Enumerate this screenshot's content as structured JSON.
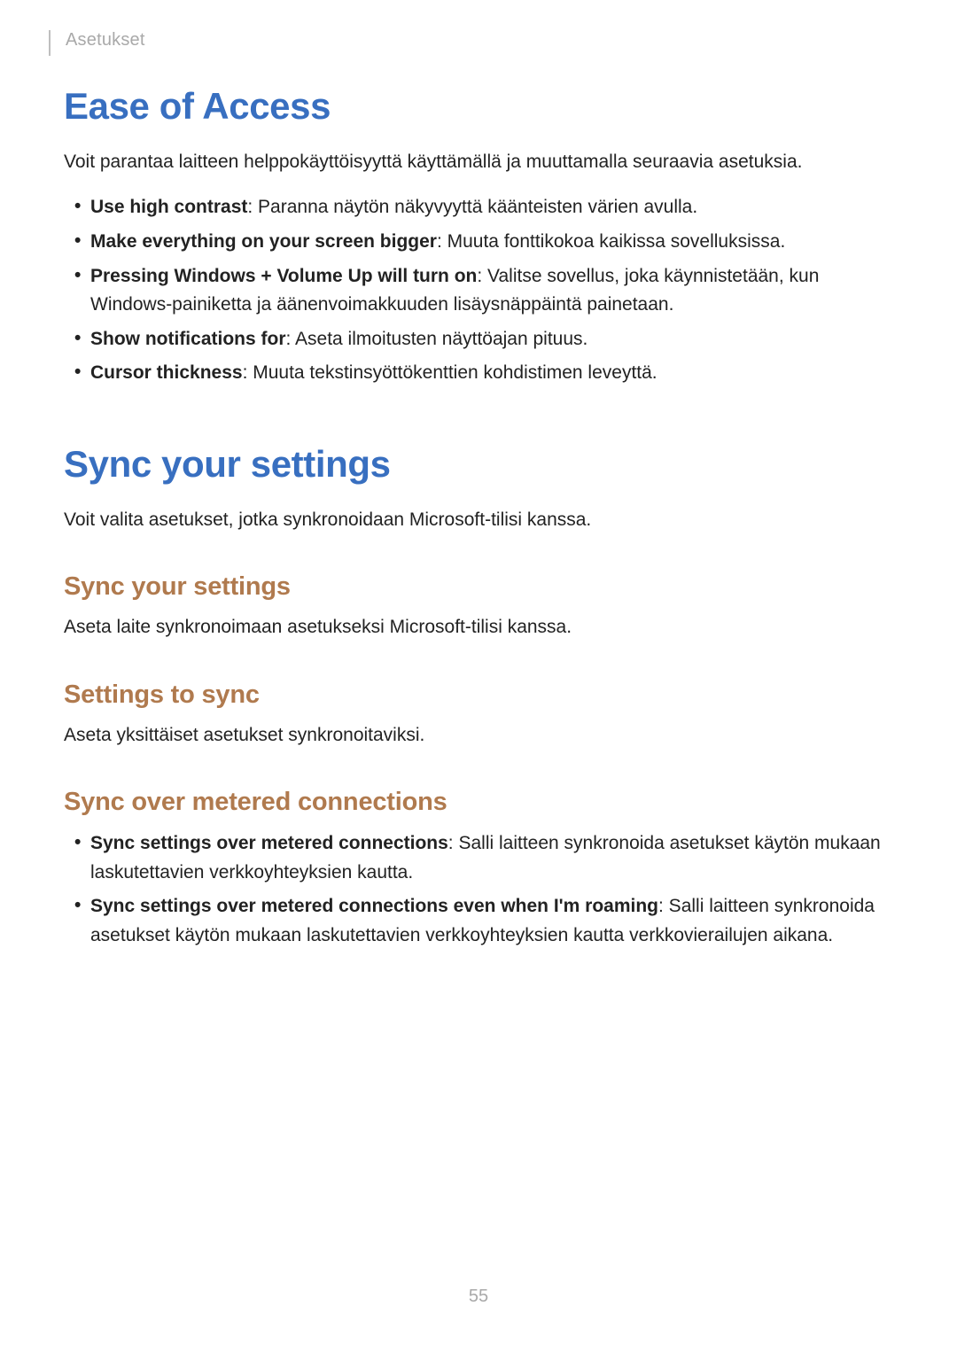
{
  "header": {
    "section": "Asetukset"
  },
  "ease": {
    "title": "Ease of Access",
    "intro": "Voit parantaa laitteen helppokäyttöisyyttä käyttämällä ja muuttamalla seuraavia asetuksia.",
    "items": [
      {
        "bold": "Use high contrast",
        "rest": ": Paranna näytön näkyvyyttä käänteisten värien avulla."
      },
      {
        "bold": "Make everything on your screen bigger",
        "rest": ": Muuta fonttikokoa kaikissa sovelluksissa."
      },
      {
        "bold": "Pressing Windows + Volume Up will turn on",
        "rest": ": Valitse sovellus, joka käynnistetään, kun Windows-painiketta ja äänenvoimakkuuden lisäysnäppäintä painetaan."
      },
      {
        "bold": "Show notifications for",
        "rest": ": Aseta ilmoitusten näyttöajan pituus."
      },
      {
        "bold": "Cursor thickness",
        "rest": ": Muuta tekstinsyöttökenttien kohdistimen leveyttä."
      }
    ]
  },
  "sync": {
    "title": "Sync your settings",
    "intro": "Voit valita asetukset, jotka synkronoidaan Microsoft-tilisi kanssa.",
    "sections": [
      {
        "heading": "Sync your settings",
        "body": "Aseta laite synkronoimaan asetukseksi Microsoft-tilisi kanssa."
      },
      {
        "heading": "Settings to sync",
        "body": "Aseta yksittäiset asetukset synkronoitaviksi."
      }
    ],
    "metered": {
      "heading": "Sync over metered connections",
      "items": [
        {
          "bold": "Sync settings over metered connections",
          "rest": ": Salli laitteen synkronoida asetukset käytön mukaan laskutettavien verkkoyhteyksien kautta."
        },
        {
          "bold": "Sync settings over metered connections even when I'm roaming",
          "rest": ": Salli laitteen synkronoida asetukset käytön mukaan laskutettavien verkkoyhteyksien kautta verkkovierailujen aikana."
        }
      ]
    }
  },
  "page_number": "55"
}
